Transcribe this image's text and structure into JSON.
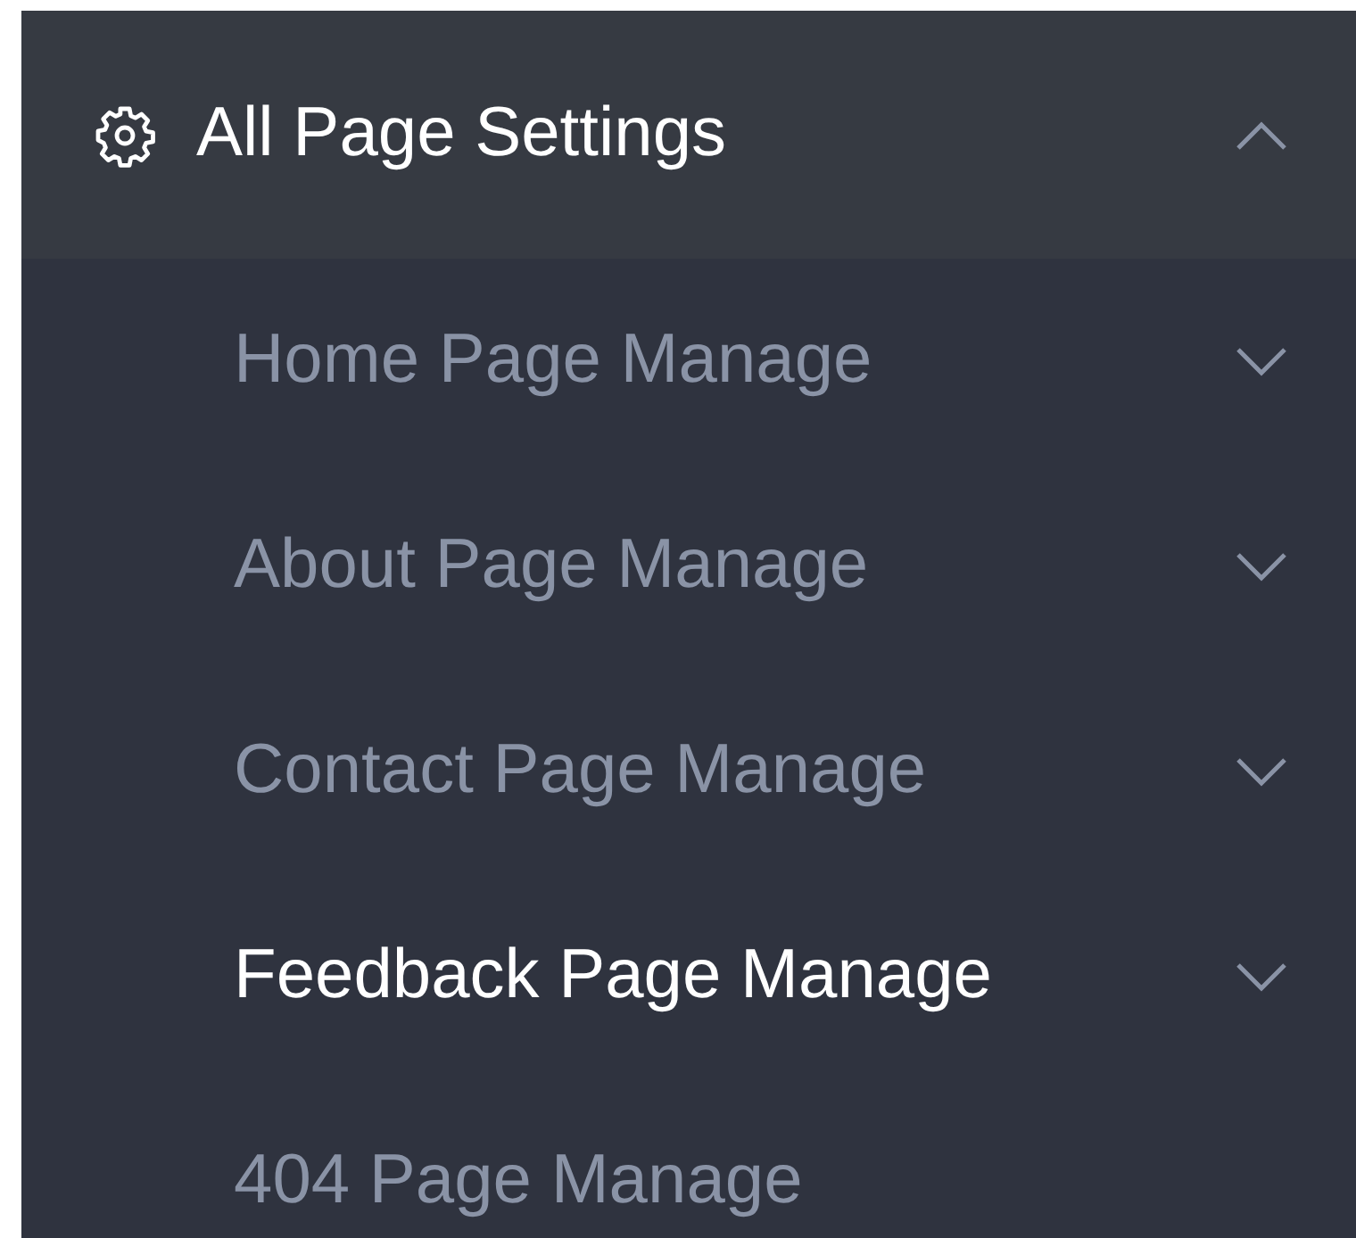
{
  "menu": {
    "title": "All Page Settings",
    "expanded": true,
    "items": [
      {
        "label": "Home Page Manage",
        "kind": "submenu",
        "selected": false
      },
      {
        "label": "About Page Manage",
        "kind": "submenu",
        "selected": false
      },
      {
        "label": "Contact Page Manage",
        "kind": "submenu",
        "selected": false
      },
      {
        "label": "Feedback Page Manage",
        "kind": "submenu",
        "selected": true
      },
      {
        "label": "404 Page Manage",
        "kind": "link",
        "selected": false
      }
    ]
  }
}
